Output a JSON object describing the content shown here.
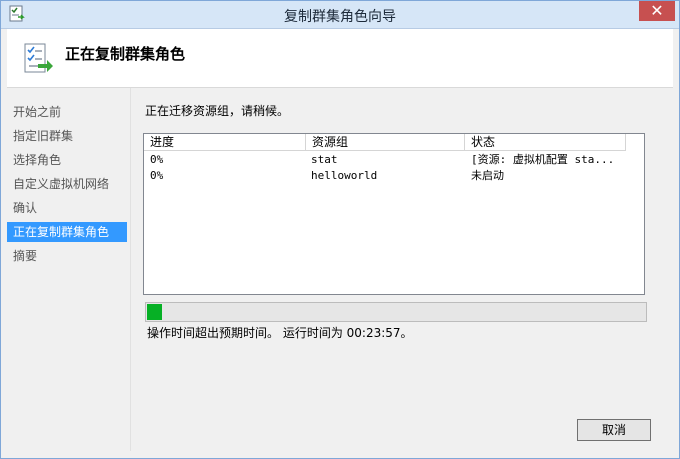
{
  "window": {
    "title": "复制群集角色向导",
    "close_label": "✕"
  },
  "header": {
    "title": "正在复制群集角色"
  },
  "sidebar": {
    "items": [
      {
        "label": "开始之前"
      },
      {
        "label": "指定旧群集"
      },
      {
        "label": "选择角色"
      },
      {
        "label": "自定义虚拟机网络"
      },
      {
        "label": "确认"
      },
      {
        "label": "正在复制群集角色",
        "active": true
      },
      {
        "label": "摘要"
      }
    ]
  },
  "main": {
    "status_message": "正在迁移资源组，请稍候。",
    "table": {
      "columns": [
        "进度",
        "资源组",
        "状态"
      ],
      "rows": [
        [
          "0%",
          "stat",
          "[资源: 虚拟机配置 sta..."
        ],
        [
          "0%",
          "helloworld",
          "未启动"
        ]
      ]
    },
    "progress_value": 0.03,
    "time_message": "操作时间超出预期时间。  运行时间为 00:23:57。"
  },
  "footer": {
    "cancel_label": "取消"
  },
  "colors": {
    "accent": "#3399ff",
    "progress": "#06b025"
  },
  "icons": {
    "title": "wizard-icon",
    "header": "checklist-arrow-icon"
  }
}
